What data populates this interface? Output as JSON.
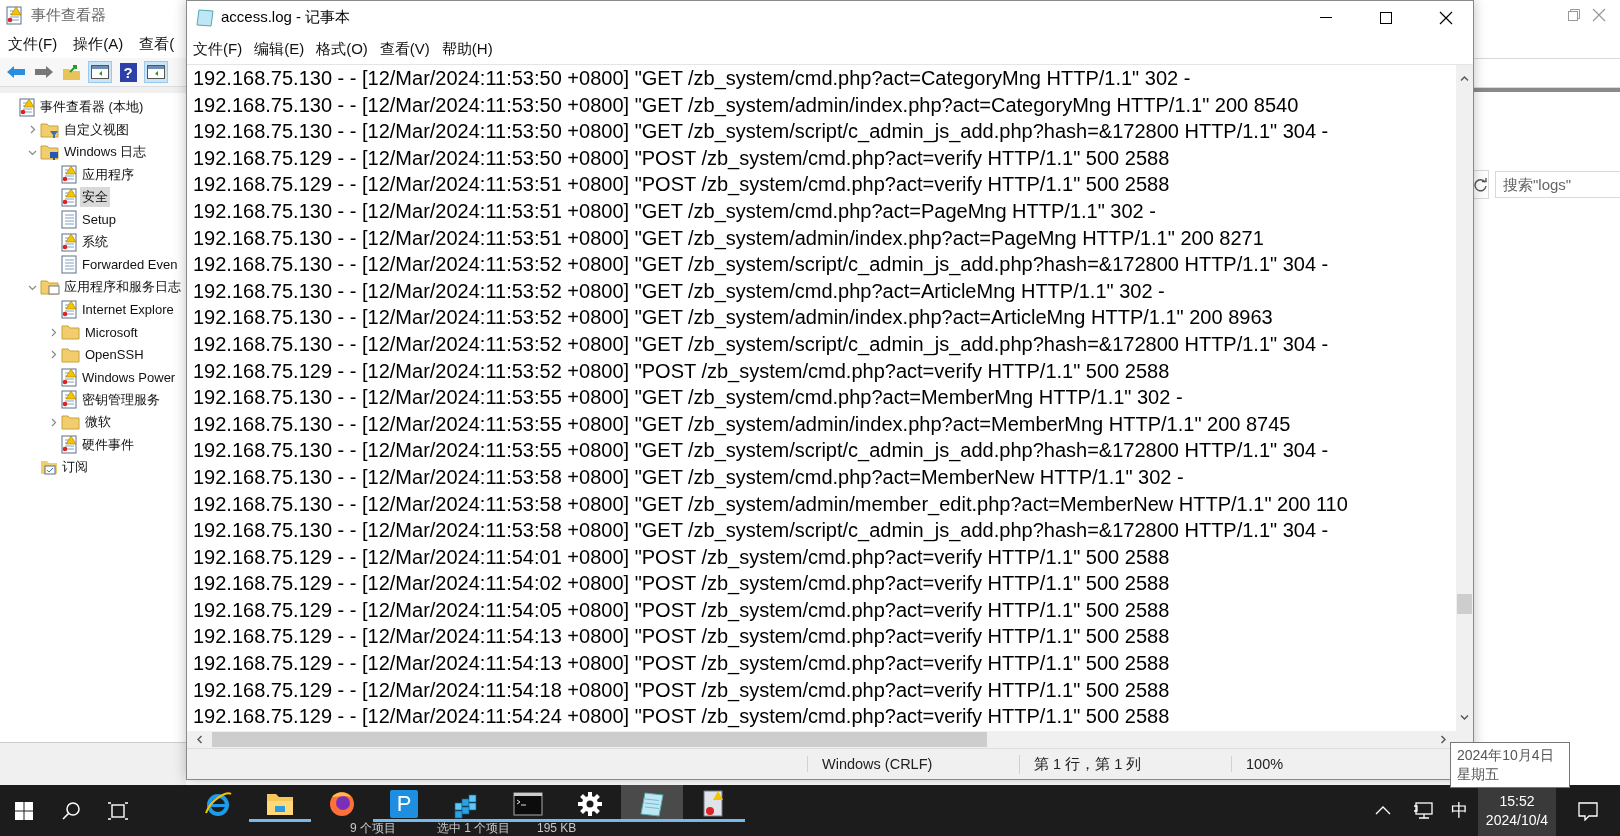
{
  "event_viewer": {
    "title": "事件查看器",
    "menu": [
      "文件(F)",
      "操作(A)",
      "查看("
    ],
    "toolbar": [
      {
        "kind": "back",
        "selected": false
      },
      {
        "kind": "forward",
        "selected": false
      },
      {
        "kind": "up-folder",
        "selected": false
      },
      {
        "kind": "panel",
        "selected": true
      },
      {
        "kind": "help",
        "glyph": "?",
        "selected": false
      },
      {
        "kind": "panel",
        "selected": true
      }
    ],
    "tree": [
      {
        "label": "事件查看器 (本地)",
        "kind": "root",
        "selected": false,
        "children": [
          {
            "label": "自定义视图",
            "kind": "filter-folder",
            "selected": false,
            "expanded": false
          },
          {
            "label": "Windows 日志",
            "kind": "monitor-folder",
            "selected": false,
            "expanded": true,
            "children": [
              {
                "label": "应用程序",
                "kind": "log",
                "selected": false
              },
              {
                "label": "安全",
                "kind": "log",
                "selected": true
              },
              {
                "label": "Setup",
                "kind": "plain-log",
                "selected": false
              },
              {
                "label": "系统",
                "kind": "log",
                "selected": false
              },
              {
                "label": "Forwarded Even",
                "kind": "plain-log",
                "selected": false
              }
            ]
          },
          {
            "label": "应用程序和服务日志",
            "kind": "open-folder",
            "selected": false,
            "expanded": true,
            "children": [
              {
                "label": "Internet Explore",
                "kind": "log",
                "selected": false
              },
              {
                "label": "Microsoft",
                "kind": "folder",
                "selected": false,
                "expanded": false
              },
              {
                "label": "OpenSSH",
                "kind": "folder",
                "selected": false,
                "expanded": false
              },
              {
                "label": "Windows Power",
                "kind": "log",
                "selected": false
              },
              {
                "label": "密钥管理服务",
                "kind": "log",
                "selected": false
              },
              {
                "label": "微软",
                "kind": "folder",
                "selected": false,
                "expanded": false
              },
              {
                "label": "硬件事件",
                "kind": "log",
                "selected": false
              }
            ]
          },
          {
            "label": "订阅",
            "kind": "subscription",
            "selected": false
          }
        ]
      }
    ]
  },
  "explorer": {
    "search": {
      "placeholder": "搜索\"logs\""
    },
    "status": [
      "9 个项目",
      "选中 1 个项目",
      "195 KB"
    ]
  },
  "notepad": {
    "title": "access.log - 记事本",
    "menu": [
      "文件(F)",
      "编辑(E)",
      "格式(O)",
      "查看(V)",
      "帮助(H)"
    ],
    "lines": [
      "192.168.75.130 - - [12/Mar/2024:11:53:50 +0800] \"GET /zb_system/cmd.php?act=CategoryMng HTTP/1.1\" 302 -",
      "192.168.75.130 - - [12/Mar/2024:11:53:50 +0800] \"GET /zb_system/admin/index.php?act=CategoryMng HTTP/1.1\" 200 8540",
      "192.168.75.130 - - [12/Mar/2024:11:53:50 +0800] \"GET /zb_system/script/c_admin_js_add.php?hash=&172800 HTTP/1.1\" 304 -",
      "192.168.75.129 - - [12/Mar/2024:11:53:50 +0800] \"POST /zb_system/cmd.php?act=verify HTTP/1.1\" 500 2588",
      "192.168.75.129 - - [12/Mar/2024:11:53:51 +0800] \"POST /zb_system/cmd.php?act=verify HTTP/1.1\" 500 2588",
      "192.168.75.130 - - [12/Mar/2024:11:53:51 +0800] \"GET /zb_system/cmd.php?act=PageMng HTTP/1.1\" 302 -",
      "192.168.75.130 - - [12/Mar/2024:11:53:51 +0800] \"GET /zb_system/admin/index.php?act=PageMng HTTP/1.1\" 200 8271",
      "192.168.75.130 - - [12/Mar/2024:11:53:52 +0800] \"GET /zb_system/script/c_admin_js_add.php?hash=&172800 HTTP/1.1\" 304 -",
      "192.168.75.130 - - [12/Mar/2024:11:53:52 +0800] \"GET /zb_system/cmd.php?act=ArticleMng HTTP/1.1\" 302 -",
      "192.168.75.130 - - [12/Mar/2024:11:53:52 +0800] \"GET /zb_system/admin/index.php?act=ArticleMng HTTP/1.1\" 200 8963",
      "192.168.75.130 - - [12/Mar/2024:11:53:52 +0800] \"GET /zb_system/script/c_admin_js_add.php?hash=&172800 HTTP/1.1\" 304 -",
      "192.168.75.129 - - [12/Mar/2024:11:53:52 +0800] \"POST /zb_system/cmd.php?act=verify HTTP/1.1\" 500 2588",
      "192.168.75.130 - - [12/Mar/2024:11:53:55 +0800] \"GET /zb_system/cmd.php?act=MemberMng HTTP/1.1\" 302 -",
      "192.168.75.130 - - [12/Mar/2024:11:53:55 +0800] \"GET /zb_system/admin/index.php?act=MemberMng HTTP/1.1\" 200 8745",
      "192.168.75.130 - - [12/Mar/2024:11:53:55 +0800] \"GET /zb_system/script/c_admin_js_add.php?hash=&172800 HTTP/1.1\" 304 -",
      "192.168.75.130 - - [12/Mar/2024:11:53:58 +0800] \"GET /zb_system/cmd.php?act=MemberNew HTTP/1.1\" 302 -",
      "192.168.75.130 - - [12/Mar/2024:11:53:58 +0800] \"GET /zb_system/admin/member_edit.php?act=MemberNew HTTP/1.1\" 200 110",
      "192.168.75.130 - - [12/Mar/2024:11:53:58 +0800] \"GET /zb_system/script/c_admin_js_add.php?hash=&172800 HTTP/1.1\" 304 -",
      "192.168.75.129 - - [12/Mar/2024:11:54:01 +0800] \"POST /zb_system/cmd.php?act=verify HTTP/1.1\" 500 2588",
      "192.168.75.129 - - [12/Mar/2024:11:54:02 +0800] \"POST /zb_system/cmd.php?act=verify HTTP/1.1\" 500 2588",
      "192.168.75.129 - - [12/Mar/2024:11:54:05 +0800] \"POST /zb_system/cmd.php?act=verify HTTP/1.1\" 500 2588",
      "192.168.75.129 - - [12/Mar/2024:11:54:13 +0800] \"POST /zb_system/cmd.php?act=verify HTTP/1.1\" 500 2588",
      "192.168.75.129 - - [12/Mar/2024:11:54:13 +0800] \"POST /zb_system/cmd.php?act=verify HTTP/1.1\" 500 2588",
      "192.168.75.129 - - [12/Mar/2024:11:54:18 +0800] \"POST /zb_system/cmd.php?act=verify HTTP/1.1\" 500 2588",
      "192.168.75.129 - - [12/Mar/2024:11:54:24 +0800] \"POST /zb_system/cmd.php?act=verify HTTP/1.1\" 500 2588"
    ],
    "status": [
      "Windows (CRLF)",
      "第 1 行，第 1 列",
      "100%"
    ]
  },
  "taskbar": {
    "apps": [
      {
        "kind": "ie",
        "running": false,
        "selected": false
      },
      {
        "kind": "file-explorer",
        "running": true,
        "selected": false
      },
      {
        "kind": "firefox",
        "running": false,
        "selected": false
      },
      {
        "kind": "letter-tile",
        "glyph": "P",
        "running": true,
        "selected": false
      },
      {
        "kind": "cubes",
        "running": true,
        "selected": false
      },
      {
        "kind": "terminal",
        "running": true,
        "selected": false
      },
      {
        "kind": "gear",
        "running": true,
        "selected": false
      },
      {
        "kind": "notepad",
        "running": true,
        "selected": true
      },
      {
        "kind": "event-viewer",
        "running": true,
        "selected": false
      }
    ],
    "ime": "中",
    "clock": {
      "time": "15:52",
      "date": "2024/10/4"
    },
    "tooltip": [
      "2024年10月4日",
      "星期五"
    ]
  }
}
